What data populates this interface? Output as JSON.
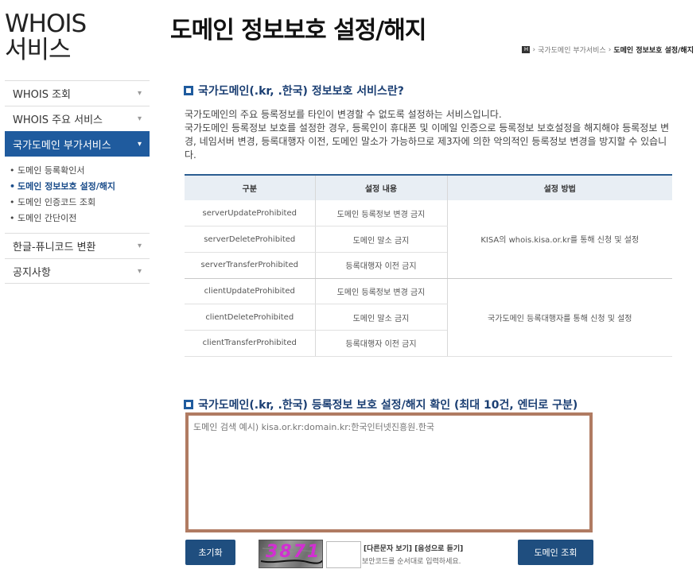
{
  "sidebar": {
    "service_title_line1": "WHOIS",
    "service_title_line2": "서비스",
    "menu": [
      {
        "label": "WHOIS 조회"
      },
      {
        "label": "WHOIS 주요 서비스"
      },
      {
        "label": "국가도메인 부가서비스"
      },
      {
        "label": "한글-퓨니코드 변환"
      },
      {
        "label": "공지사항"
      }
    ],
    "submenu": [
      {
        "label": "도메인 등록확인서"
      },
      {
        "label": "도메인 정보보호 설정/해지"
      },
      {
        "label": "도메인 인증코드 조회"
      },
      {
        "label": "도메인 간단이전"
      }
    ],
    "bullet": "•",
    "chevron": "▾"
  },
  "header": {
    "title": "도메인 정보보호 설정/해지",
    "breadcrumb": {
      "home_icon": "home-icon",
      "home_label": "H",
      "separator": "›",
      "parent": "국가도메인 부가서비스",
      "current": "도메인 정보보호 설정/해지"
    }
  },
  "section1": {
    "heading": "국가도메인(.kr, .한국) 정보보호 서비스란?",
    "desc_line1": "국가도메인의 주요 등록정보를 타인이 변경할 수 없도록 설정하는 서비스입니다.",
    "desc_line2": "국가도메인 등록정보 보호를 설정한 경우, 등록인이 휴대폰 및 이메일 인증으로 등록정보 보호설정을 해지해야 등록정보 변경, 네임서버 변경, 등록대행자 이전, 도메인 말소가 가능하므로 제3자에 의한 악의적인 등록정보 변경을 방지할 수 있습니다."
  },
  "table": {
    "headers": [
      "구분",
      "설정 내용",
      "설정 방법"
    ],
    "rows": [
      {
        "code": "serverUpdateProhibited",
        "desc": "도메인 등록정보 변경 금지"
      },
      {
        "code": "serverDeleteProhibited",
        "desc": "도메인 말소 금지"
      },
      {
        "code": "serverTransferProhibited",
        "desc": "등록대행자 이전 금지"
      },
      {
        "code": "clientUpdateProhibited",
        "desc": "도메인 등록정보 변경 금지"
      },
      {
        "code": "clientDeleteProhibited",
        "desc": "도메인 말소 금지"
      },
      {
        "code": "clientTransferProhibited",
        "desc": "등록대행자 이전 금지"
      }
    ],
    "method_server": "KISA의 whois.kisa.or.kr를 통해 신청 및 설정",
    "method_client": "국가도메인 등록대행자를 통해 신청 및 설정"
  },
  "section2": {
    "heading": "국가도메인(.kr, .한국) 등록정보 보호 설정/해지 확인 (최대 10건, 엔터로 구분)",
    "textarea_placeholder": "도메인 검색 예시) kisa.or.kr:domain.kr:한국인터넷진흥원.한국",
    "textarea_value": ""
  },
  "actions": {
    "reset_label": "초기화",
    "lookup_label": "도메인 조회",
    "captcha_text": "3871",
    "captcha_input_value": "",
    "captcha_other_link": "[다른문자 보기]",
    "captcha_audio_link": "[음성으로 듣기]",
    "captcha_hint": "보안코드를 순서대로 입력하세요."
  },
  "colors": {
    "primary": "#1f5b9e",
    "button": "#1f4e7f",
    "textarea_border": "#b07b62",
    "heading": "#1b3f73",
    "captcha_text": "#d22fd2"
  }
}
